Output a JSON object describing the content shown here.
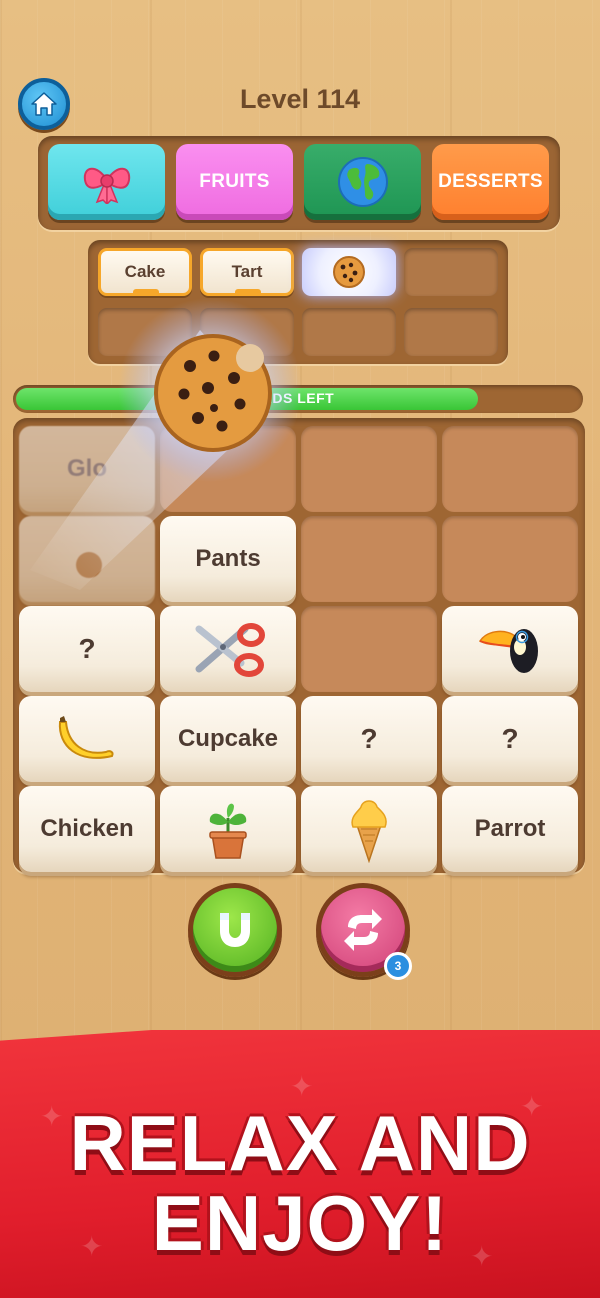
{
  "header": {
    "level_title": "Level 114"
  },
  "categories": [
    {
      "label": "",
      "icon": "bow-icon",
      "color": "#3fcfd9"
    },
    {
      "label": "FRUITS",
      "icon": "",
      "color": "#ef6be0"
    },
    {
      "label": "",
      "icon": "globe-icon",
      "color": "#1e9553"
    },
    {
      "label": "DESSERTS",
      "icon": "",
      "color": "#ff7f2e"
    }
  ],
  "slots": {
    "filled": [
      "Cake",
      "Tart"
    ],
    "active_icon": "cookie-icon"
  },
  "progress": {
    "label": "RDS LEFT",
    "fraction": 0.82,
    "color": "#39c636"
  },
  "board": {
    "rows": [
      [
        {
          "text": "Glo"
        },
        {
          "text": ""
        },
        {
          "text": ""
        },
        {
          "text": ""
        }
      ],
      [
        {
          "text": ""
        },
        {
          "text": "Pants"
        },
        {
          "text": ""
        },
        {
          "text": ""
        }
      ],
      [
        {
          "text": "?"
        },
        {
          "icon": "scissors-icon"
        },
        {
          "text": ""
        },
        {
          "icon": "toucan-icon"
        }
      ],
      [
        {
          "icon": "banana-icon"
        },
        {
          "text": "Cupcake"
        },
        {
          "text": "?"
        },
        {
          "text": "?"
        }
      ],
      [
        {
          "text": "Chicken"
        },
        {
          "icon": "plant-icon"
        },
        {
          "icon": "ice-cream-icon"
        },
        {
          "text": "Parrot"
        }
      ]
    ]
  },
  "boosters": {
    "magnet_icon": "magnet-icon",
    "shuffle_icon": "shuffle-icon",
    "shuffle_count": "3"
  },
  "banner": {
    "line1": "RELAX AND",
    "line2": "ENJOY!",
    "color": "#e11e2c"
  }
}
